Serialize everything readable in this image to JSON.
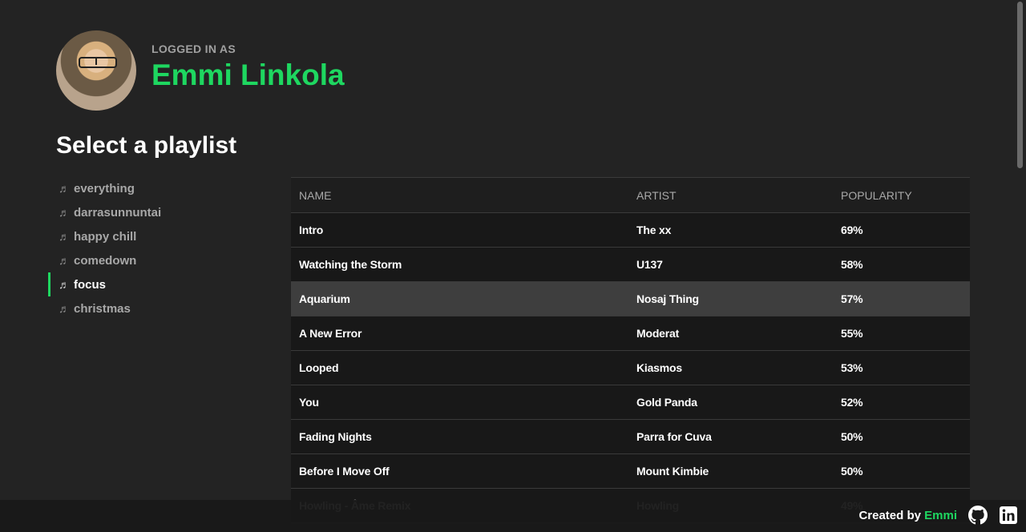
{
  "user": {
    "logged_label": "LOGGED IN AS",
    "name": "Emmi Linkola"
  },
  "section_title": "Select a playlist",
  "playlists": [
    {
      "label": "everything",
      "active": false
    },
    {
      "label": "darrasunnuntai",
      "active": false
    },
    {
      "label": "happy chill",
      "active": false
    },
    {
      "label": "comedown",
      "active": false
    },
    {
      "label": "focus",
      "active": true
    },
    {
      "label": "christmas",
      "active": false
    }
  ],
  "table": {
    "headers": [
      "NAME",
      "ARTIST",
      "POPULARITY"
    ],
    "rows": [
      {
        "name": "Intro",
        "artist": "The xx",
        "popularity": "69%"
      },
      {
        "name": "Watching the Storm",
        "artist": "U137",
        "popularity": "58%"
      },
      {
        "name": "Aquarium",
        "artist": "Nosaj Thing",
        "popularity": "57%"
      },
      {
        "name": "A New Error",
        "artist": "Moderat",
        "popularity": "55%"
      },
      {
        "name": "Looped",
        "artist": "Kiasmos",
        "popularity": "53%"
      },
      {
        "name": "You",
        "artist": "Gold Panda",
        "popularity": "52%"
      },
      {
        "name": "Fading Nights",
        "artist": "Parra for Cuva",
        "popularity": "50%"
      },
      {
        "name": "Before I Move Off",
        "artist": "Mount Kimbie",
        "popularity": "50%"
      },
      {
        "name": "Howling - Âme Remix",
        "artist": "Howling",
        "popularity": "49%"
      }
    ]
  },
  "footer": {
    "created_by": "Created by",
    "author": "Emmi"
  },
  "colors": {
    "accent": "#1ed760",
    "background": "#232323"
  }
}
